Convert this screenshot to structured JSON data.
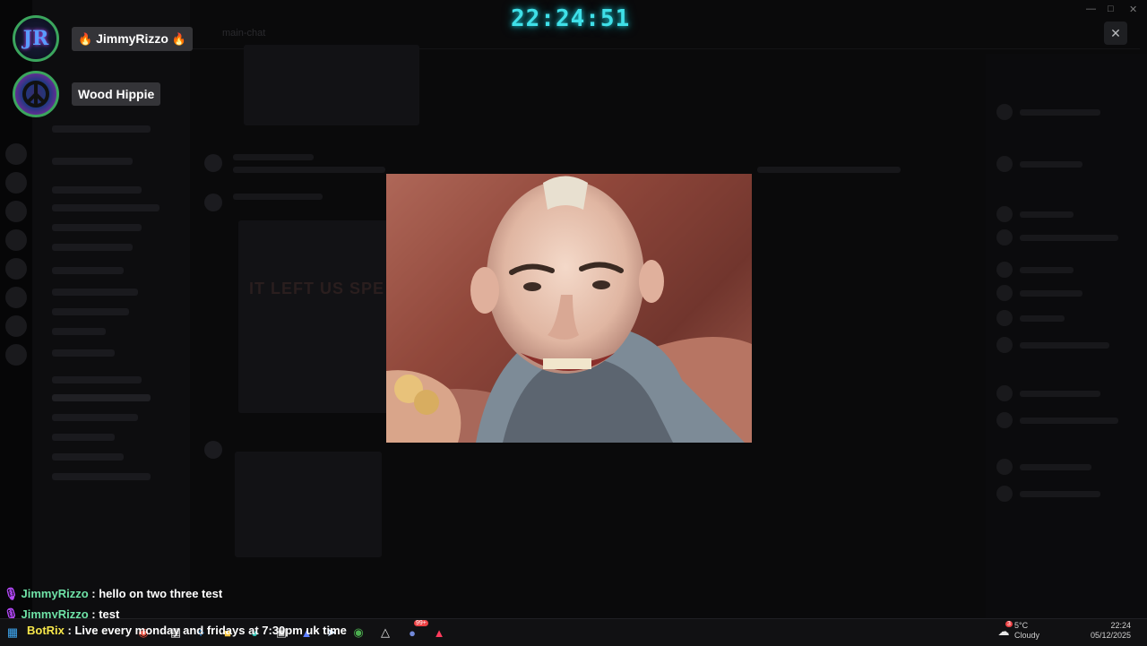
{
  "clock": {
    "time": "22:24:51"
  },
  "background_channel": {
    "name": "main-chat"
  },
  "background_embed": {
    "caption": "IT LEFT US SPE"
  },
  "voice_users": [
    {
      "name": "JimmyRizzo",
      "avatar": "JR",
      "flair": "fire-emoji"
    },
    {
      "name": "Wood Hippie",
      "avatar": "peace-sign",
      "flair": ""
    }
  ],
  "overlay": {
    "close_icon": "close-icon"
  },
  "chat": [
    {
      "user": "JimmyRizzo",
      "separator": " : ",
      "message": "hello on two three test"
    },
    {
      "user": "JimmyRizzo",
      "separator": " : ",
      "message": "test"
    }
  ],
  "ticker": {
    "user": "BotRix",
    "separator": " : ",
    "message": "Live every monday and fridays at 7:30pm uk time"
  },
  "taskbar": {
    "icons": [
      "start-icon",
      "chrome-icon",
      "file-explorer-icon",
      "vscode-icon",
      "folder-icon",
      "edge-icon",
      "store-icon",
      "teams-icon",
      "steam-icon",
      "chrome-icon",
      "obs-icon",
      "discord-icon",
      "game-icon"
    ],
    "discord_badge": "99+",
    "weather": {
      "temp": "5°C",
      "condition": "Cloudy",
      "badge": "3"
    },
    "time": "22:24",
    "date": "05/12/2025"
  },
  "colors": {
    "clock": "#3fe0e8",
    "speaking_ring": "#3ba55d",
    "chat_user": "#6fe3a7",
    "ticker_user": "#f6e64a"
  }
}
